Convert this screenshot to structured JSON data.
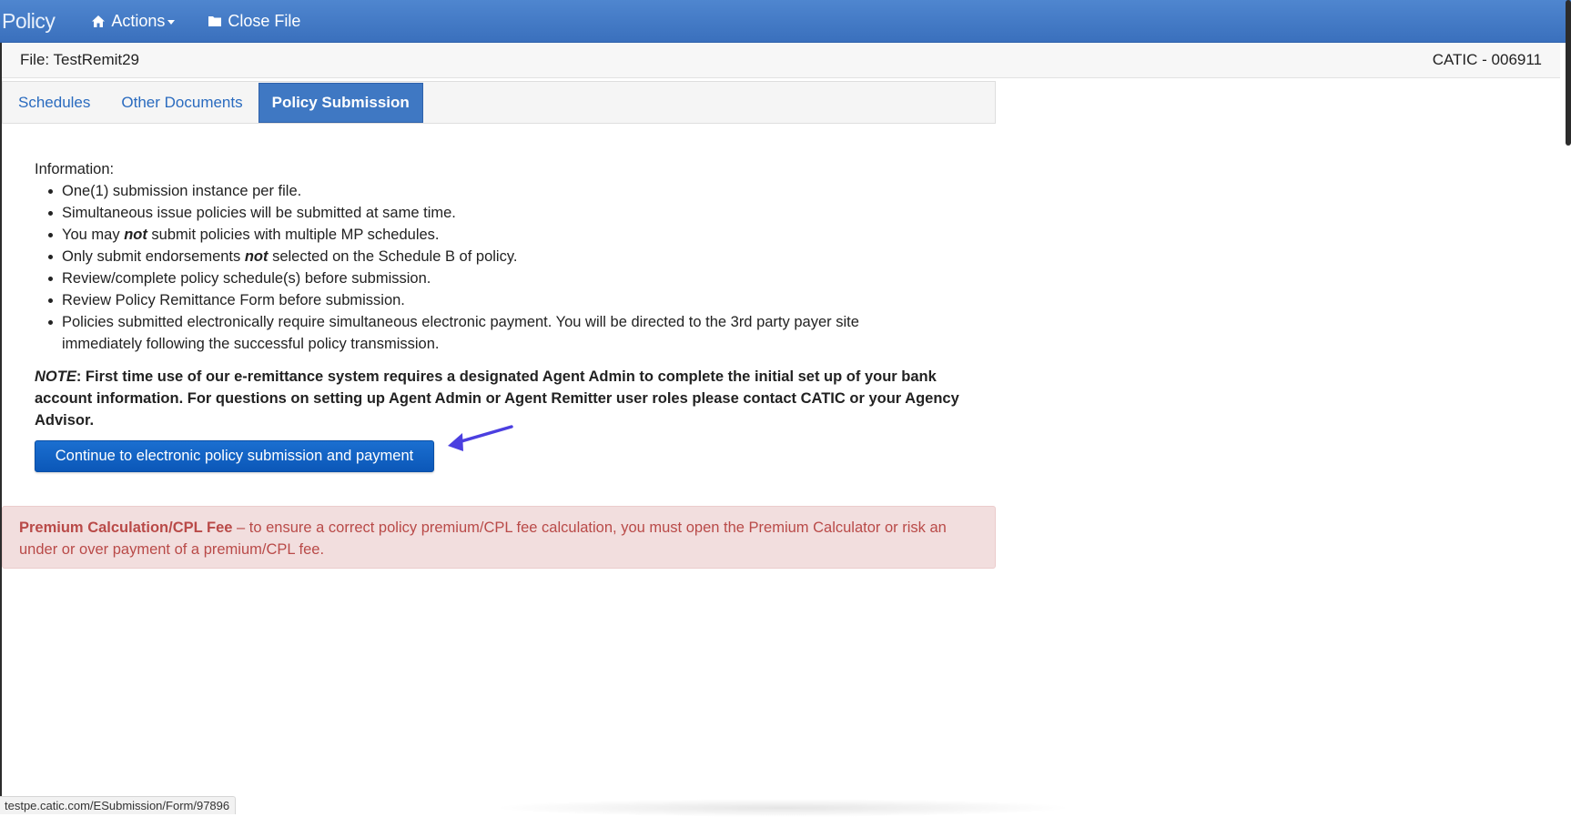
{
  "navbar": {
    "brand": "Policy",
    "actions_label": "Actions",
    "close_file_label": "Close File",
    "home_icon": "home-icon",
    "folder_icon": "folder-icon"
  },
  "filebar": {
    "file_label": "File: TestRemit29",
    "agency_code": "CATIC - 006911"
  },
  "tabs": [
    {
      "label": "Schedules",
      "active": false
    },
    {
      "label": "Other Documents",
      "active": false
    },
    {
      "label": "Policy Submission",
      "active": true
    }
  ],
  "info": {
    "heading": "Information:",
    "items": [
      {
        "before": "One(1) submission instance per file.",
        "emph": "",
        "after": ""
      },
      {
        "before": "Simultaneous issue policies will be submitted at same time.",
        "emph": "",
        "after": ""
      },
      {
        "before": "You may ",
        "emph": "not",
        "after": " submit policies with multiple MP schedules."
      },
      {
        "before": "Only submit endorsements ",
        "emph": "not",
        "after": " selected on the Schedule B of policy."
      },
      {
        "before": "Review/complete policy schedule(s) before submission.",
        "emph": "",
        "after": ""
      },
      {
        "before": "Review Policy Remittance Form before submission.",
        "emph": "",
        "after": ""
      },
      {
        "before": "Policies submitted electronically require simultaneous electronic payment. You will be directed to the 3rd party payer site immediately following the successful policy transmission.",
        "emph": "",
        "after": ""
      }
    ]
  },
  "note": {
    "label": "NOTE",
    "text": ": First time use of our e-remittance system requires a designated Agent Admin to complete the initial set up of your bank account information. For questions on setting up Agent Admin or Agent Remitter user roles please contact CATIC or your Agency Advisor."
  },
  "continue_button_label": "Continue to electronic policy submission and payment",
  "alert": {
    "title": "Premium Calculation/CPL Fee",
    "text": " – to ensure a correct policy premium/CPL fee calculation, you must open the Premium Calculator or risk an under or over payment of a premium/CPL fee."
  },
  "status_url": "testpe.catic.com/ESubmission/Form/97896",
  "colors": {
    "navbar": "#3f78c3",
    "button": "#0b57b8",
    "alert_bg": "#f2dede",
    "alert_text": "#b94a48",
    "arrow": "#4b3fe0"
  }
}
